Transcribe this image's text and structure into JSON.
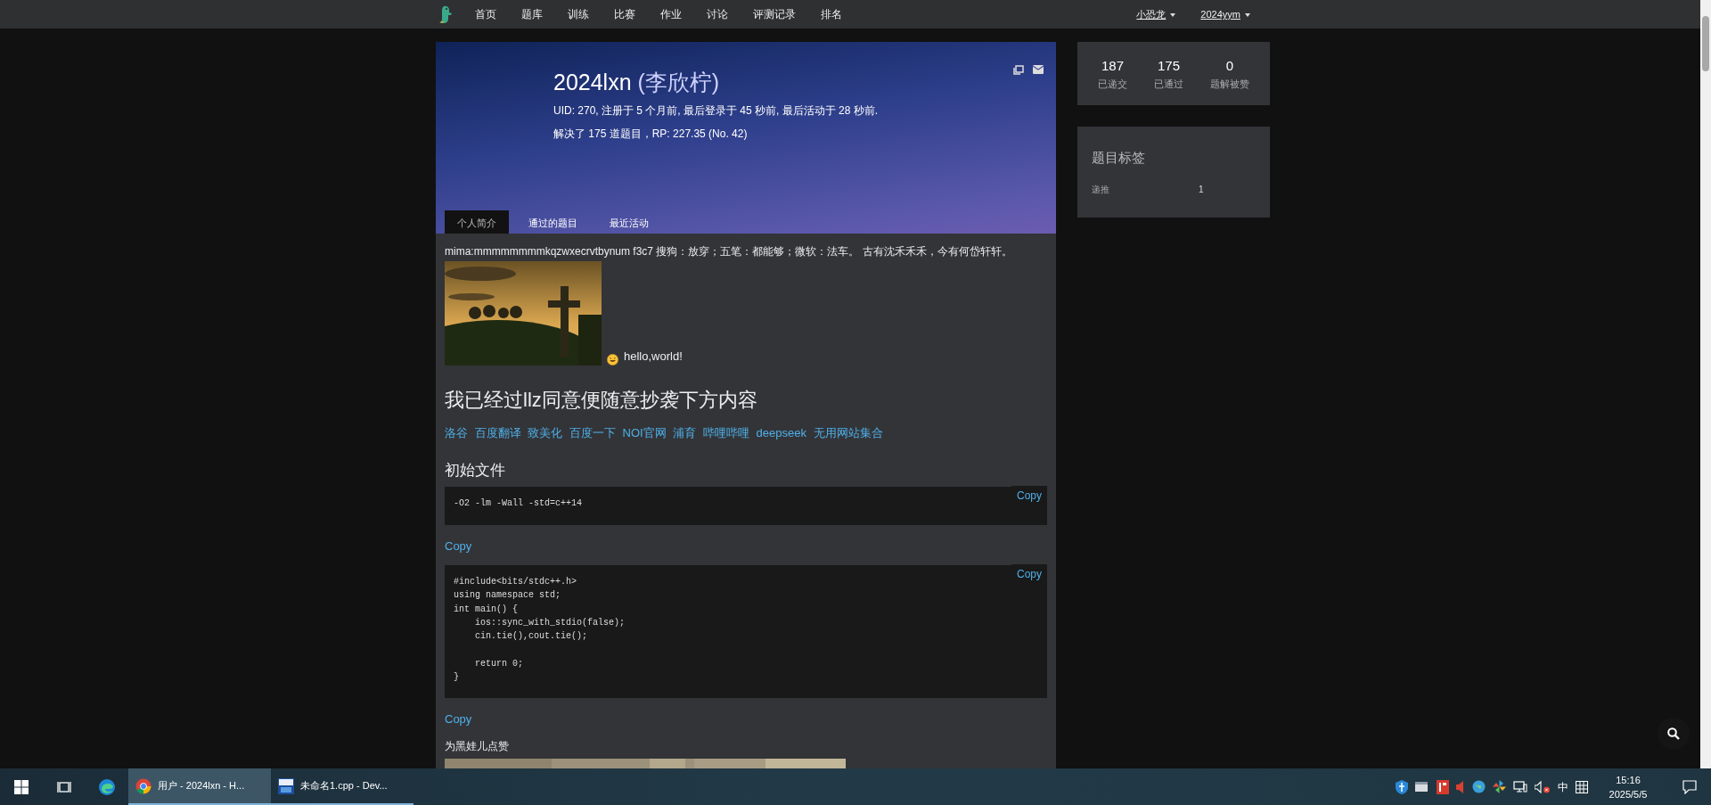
{
  "nav": {
    "items": [
      "首页",
      "题库",
      "训练",
      "比赛",
      "作业",
      "讨论",
      "评测记录",
      "排名"
    ],
    "user_menus": [
      "小恐龙",
      "2024yym"
    ]
  },
  "profile": {
    "username": "2024lxn",
    "realname": "(李欣柠)",
    "info": "UID: 270, 注册于 5 个月前, 最后登录于 45 秒前, 最后活动于 28 秒前.",
    "solved": "解决了 175 道题目，RP: 227.35 (No. 42)"
  },
  "tabs": [
    {
      "label": "个人简介",
      "selected": true
    },
    {
      "label": "通过的题目",
      "selected": false
    },
    {
      "label": "最近活动",
      "selected": false
    }
  ],
  "bio": [
    {
      "kind": "paragraph",
      "text": "mima:mmmmmmmmkqzwxecrvtbynum f3c7 搜狗：放穿；五笔：都能够；微软：法车。 古有沈禾禾禾，今有何岱轩轩。"
    },
    {
      "kind": "picture_line",
      "text": "hello,world!"
    },
    {
      "kind": "heading",
      "text": "我已经过llz同意便随意抄袭下方内容"
    },
    {
      "kind": "links",
      "items": [
        "洛谷",
        "百度翻译",
        "致美化",
        "百度一下",
        "NOI官网",
        "浦育",
        "哔哩哔哩",
        "deepseek",
        "无用网站集合"
      ]
    },
    {
      "kind": "subheading",
      "text": "初始文件"
    },
    {
      "kind": "code",
      "copy": "Copy",
      "text": "-O2 -lm -Wall -std=c++14"
    },
    {
      "kind": "copy_link",
      "text": "Copy"
    },
    {
      "kind": "code",
      "copy": "Copy",
      "text": "#include<bits/stdc++.h>\nusing namespace std;\nint main() {\n    ios::sync_with_stdio(false);\n    cin.tie(),cout.tie();\n\n    return 0;\n}"
    },
    {
      "kind": "copy_link",
      "text": "Copy"
    },
    {
      "kind": "paragraph",
      "text": "为黑娃儿点赞"
    },
    {
      "kind": "picture"
    }
  ],
  "stats": [
    {
      "value": "187",
      "label": "已递交"
    },
    {
      "value": "175",
      "label": "已通过"
    },
    {
      "value": "0",
      "label": "题解被赞"
    }
  ],
  "tags": {
    "title": "题目标签",
    "rows": [
      {
        "name": "递推",
        "count": "1"
      }
    ]
  },
  "taskbar": {
    "apps": [
      {
        "kind": "browser",
        "label": "用户 - 2024lxn - H...",
        "selected": true
      },
      {
        "kind": "ide",
        "label": "未命名1.cpp - Dev...",
        "selected": false
      }
    ],
    "ime": "中",
    "time": "15:16",
    "date": "2025/5/5"
  }
}
